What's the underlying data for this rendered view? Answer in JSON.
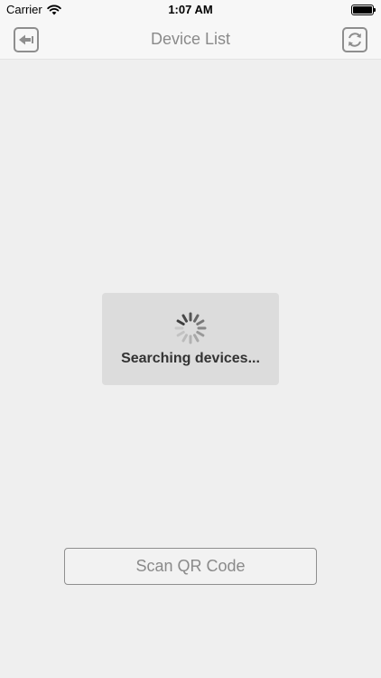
{
  "status_bar": {
    "carrier": "Carrier",
    "time": "1:07 AM",
    "wifi_icon": "wifi-icon",
    "battery_icon": "battery-full-icon"
  },
  "nav": {
    "title": "Device List",
    "back_icon": "back-arrow-icon",
    "refresh_icon": "refresh-icon"
  },
  "loading": {
    "message": "Searching devices...",
    "icon": "spinner-icon"
  },
  "scan_button": {
    "label": "Scan QR Code"
  },
  "colors": {
    "background": "#efefef",
    "nav_bg": "#f7f7f7",
    "hud_bg": "#dcdcdc",
    "muted_text": "#8a8a8a"
  }
}
